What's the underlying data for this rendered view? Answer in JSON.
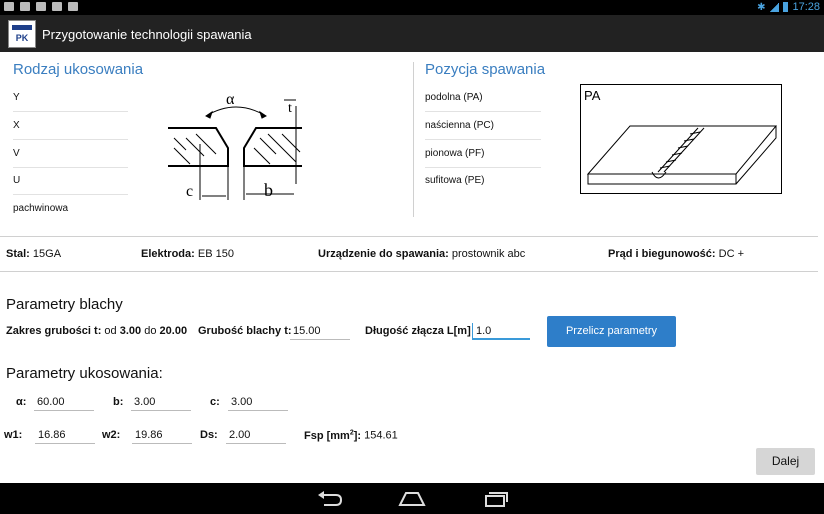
{
  "status_bar": {
    "time": "17:28"
  },
  "app": {
    "title": "Przygotowanie technologii spawania",
    "logo_text": "PK"
  },
  "groove": {
    "title": "Rodzaj ukosowania",
    "items": [
      "Y",
      "X",
      "V",
      "U",
      "pachwinowa"
    ],
    "diagram_labels": {
      "alpha": "α",
      "b": "b",
      "c": "c",
      "t": "t"
    }
  },
  "position": {
    "title": "Pozycja spawania",
    "items": [
      "podolna (PA)",
      "naścienna (PC)",
      "pionowa (PF)",
      "sufitowa (PE)"
    ],
    "image_label": "PA"
  },
  "info": {
    "stal_label": "Stal:",
    "stal_value": "15GA",
    "elektroda_label": "Elektroda:",
    "elektroda_value": "EB 150",
    "urzadzenie_label": "Urządzenie do spawania:",
    "urzadzenie_value": "prostownik abc",
    "prad_label": "Prąd i biegunowość:",
    "prad_value": "DC +"
  },
  "sheet": {
    "title": "Parametry blachy",
    "range_label": "Zakres grubości t:",
    "range_from_word": "od",
    "range_from": "3.00",
    "range_to_word": "do",
    "range_to": "20.00",
    "thickness_label": "Grubość blachy t:",
    "thickness_value": "15.00",
    "length_label": "Długość złącza L[m]",
    "length_value": "1.0",
    "calc_button": "Przelicz parametry"
  },
  "bevel": {
    "title": "Parametry ukosowania:",
    "alpha_label": "α:",
    "alpha_value": "60.00",
    "b_label": "b:",
    "b_value": "3.00",
    "c_label": "c:",
    "c_value": "3.00",
    "w1_label": "w1:",
    "w1_value": "16.86",
    "w2_label": "w2:",
    "w2_value": "19.86",
    "ds_label": "Ds:",
    "ds_value": "2.00",
    "fsp_label_pre": "Fsp [mm",
    "fsp_label_sup": "2",
    "fsp_label_post": "]:",
    "fsp_value": "154.61"
  },
  "footer": {
    "next_button": "Dalej"
  }
}
